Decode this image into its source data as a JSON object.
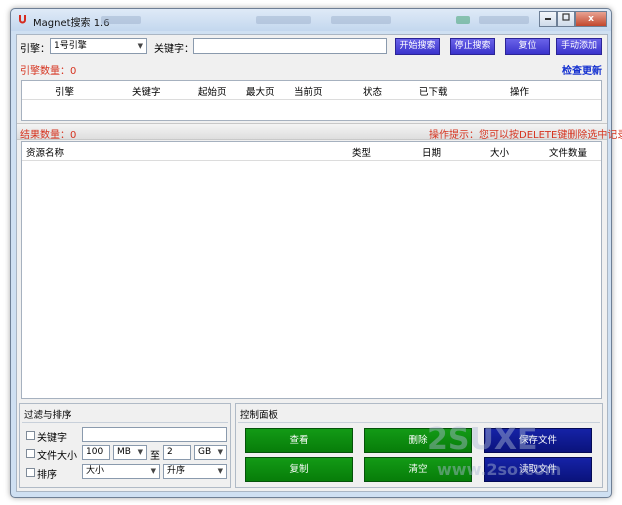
{
  "window": {
    "title": "Magnet搜索 1.6",
    "close_glyph": "x"
  },
  "toolbar": {
    "engine_label": "引擎：",
    "engine_value": "1号引擎",
    "keyword_label": "关键字：",
    "keyword_value": "",
    "start_search": "开始搜索",
    "stop_search": "停止搜索",
    "reset": "复位",
    "manual_add": "手动添加"
  },
  "engine_section": {
    "count_label": "引擎数量：0",
    "check_update": "检查更新",
    "columns": [
      "引擎",
      "关键字",
      "起始页",
      "最大页",
      "当前页",
      "状态",
      "已下载",
      "操作"
    ]
  },
  "result_section": {
    "count_label": "结果数量：0",
    "hint": "操作提示：您可以按DELETE键删除选中记录",
    "columns": [
      "资源名称",
      "类型",
      "日期",
      "大小",
      "文件数量"
    ]
  },
  "filter_panel": {
    "title": "过滤与排序",
    "keyword_label": "关键字",
    "keyword_value": "",
    "filesize_label": "文件大小",
    "size_from": "100",
    "unit_from": "MB",
    "to_label": "至",
    "size_to": "2",
    "unit_to": "GB",
    "sort_label": "排序",
    "sort_by": "大小",
    "sort_order": "升序"
  },
  "control_panel": {
    "title": "控制面板",
    "view": "查看",
    "delete": "删除",
    "save_file": "保存文件",
    "copy": "复制",
    "clear": "清空",
    "read_file": "读取文件"
  },
  "colors": {
    "accent_blue": "#4b44dd",
    "green_button": "#0b8a0e",
    "navy_button": "#0d1690",
    "hint_red": "#d6331f",
    "link_blue": "#1632d0"
  }
}
